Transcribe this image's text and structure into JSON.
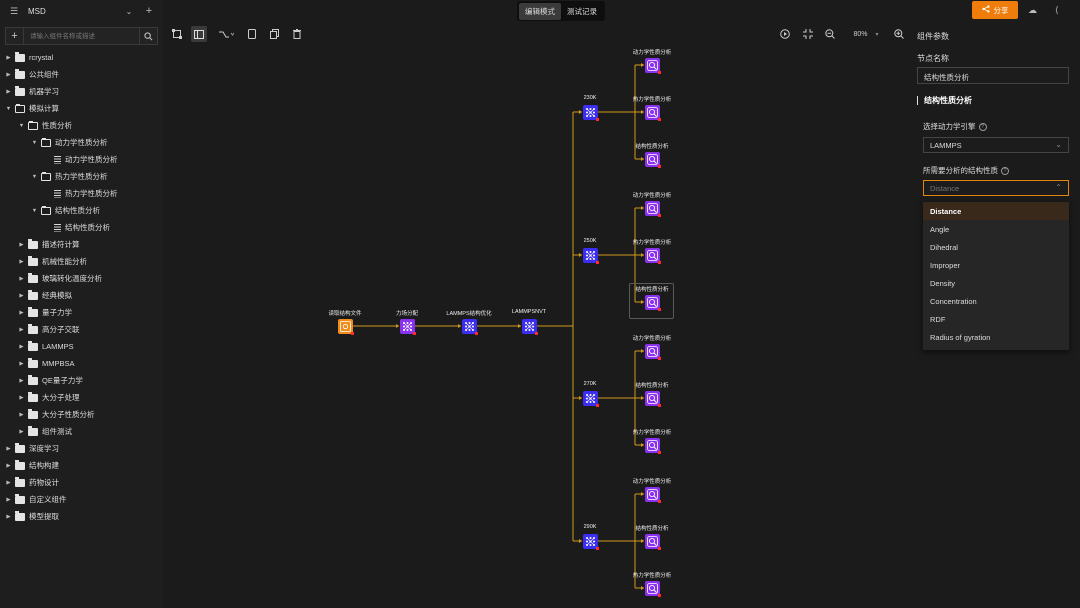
{
  "sidebar": {
    "title": "MSD",
    "search_placeholder": "请输入组件名称或描述",
    "tree": [
      {
        "label": "rcrystal",
        "level": 0,
        "type": "folder",
        "expanded": false
      },
      {
        "label": "公共组件",
        "level": 0,
        "type": "folder",
        "expanded": false
      },
      {
        "label": "机器学习",
        "level": 0,
        "type": "folder",
        "expanded": false
      },
      {
        "label": "模拟计算",
        "level": 0,
        "type": "folder",
        "expanded": true
      },
      {
        "label": "性质分析",
        "level": 1,
        "type": "folder",
        "expanded": true
      },
      {
        "label": "动力学性质分析",
        "level": 2,
        "type": "folder",
        "expanded": true
      },
      {
        "label": "动力学性质分析",
        "level": 3,
        "type": "file"
      },
      {
        "label": "热力学性质分析",
        "level": 2,
        "type": "folder",
        "expanded": true
      },
      {
        "label": "热力学性质分析",
        "level": 3,
        "type": "file"
      },
      {
        "label": "结构性质分析",
        "level": 2,
        "type": "folder",
        "expanded": true
      },
      {
        "label": "结构性质分析",
        "level": 3,
        "type": "file"
      },
      {
        "label": "描述符计算",
        "level": 1,
        "type": "folder",
        "expanded": false
      },
      {
        "label": "机械性能分析",
        "level": 1,
        "type": "folder",
        "expanded": false
      },
      {
        "label": "玻璃转化温度分析",
        "level": 1,
        "type": "folder",
        "expanded": false
      },
      {
        "label": "经典模拟",
        "level": 1,
        "type": "folder",
        "expanded": false
      },
      {
        "label": "量子力学",
        "level": 1,
        "type": "folder",
        "expanded": false
      },
      {
        "label": "高分子交联",
        "level": 1,
        "type": "folder",
        "expanded": false
      },
      {
        "label": "LAMMPS",
        "level": 1,
        "type": "folder",
        "expanded": false
      },
      {
        "label": "MMPBSA",
        "level": 1,
        "type": "folder",
        "expanded": false
      },
      {
        "label": "QE量子力学",
        "level": 1,
        "type": "folder",
        "expanded": false
      },
      {
        "label": "大分子处理",
        "level": 1,
        "type": "folder",
        "expanded": false
      },
      {
        "label": "大分子性质分析",
        "level": 1,
        "type": "folder",
        "expanded": false
      },
      {
        "label": "组件测试",
        "level": 1,
        "type": "folder",
        "expanded": false
      },
      {
        "label": "深度学习",
        "level": 0,
        "type": "folder",
        "expanded": false
      },
      {
        "label": "结构构建",
        "level": 0,
        "type": "folder",
        "expanded": false
      },
      {
        "label": "药物设计",
        "level": 0,
        "type": "folder",
        "expanded": false
      },
      {
        "label": "自定义组件",
        "level": 0,
        "type": "folder",
        "expanded": false
      },
      {
        "label": "模型提取",
        "level": 0,
        "type": "folder",
        "expanded": false
      }
    ]
  },
  "topbar": {
    "mode_edit": "编辑模式",
    "mode_test": "测试记录",
    "share_label": "分享"
  },
  "toolbar": {
    "zoom": "80%"
  },
  "canvas": {
    "main_chain": [
      "读取结构文件",
      "力场分配",
      "LAMMPS结构优化",
      "LAMMPSNVT"
    ],
    "temps": [
      "230K",
      "250K",
      "270K",
      "290K"
    ],
    "branches": [
      [
        "动力学性质分析",
        "热力学性质分析",
        "结构性质分析"
      ],
      [
        "动力学性质分析",
        "热力学性质分析",
        "结构性质分析"
      ],
      [
        "动力学性质分析",
        "结构性质分析",
        "热力学性质分析"
      ],
      [
        "动力学性质分析",
        "结构性质分析",
        "热力学性质分析"
      ]
    ],
    "colors": {
      "edge": "#d29a1e",
      "violet": "#8a31ef",
      "blue": "#3c2ef0",
      "orange": "#f08c1b",
      "port": "#ff2a2a"
    }
  },
  "panel": {
    "title": "组件参数",
    "node_name_label": "节点名称",
    "node_name_value": "结构性质分析",
    "section_title": "结构性质分析",
    "engine_label": "选择动力学引擎",
    "engine_value": "LAMMPS",
    "property_label": "所需要分析的结构性质",
    "property_placeholder": "Distance",
    "options": [
      "Distance",
      "Angle",
      "Dihedral",
      "Improper",
      "Density",
      "Concentration",
      "RDF",
      "Radius of gyration"
    ],
    "selected_option": "Distance"
  }
}
